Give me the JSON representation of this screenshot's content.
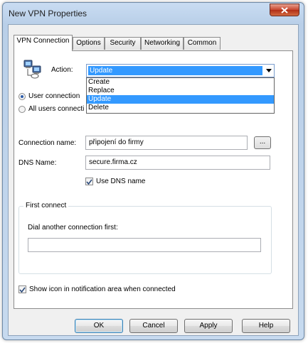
{
  "window": {
    "title": "New VPN Properties"
  },
  "tabs": [
    {
      "label": "VPN Connection",
      "active": true
    },
    {
      "label": "Options",
      "active": false
    },
    {
      "label": "Security",
      "active": false
    },
    {
      "label": "Networking",
      "active": false
    },
    {
      "label": "Common",
      "active": false
    }
  ],
  "action": {
    "label": "Action:",
    "value": "Update",
    "options": [
      "Create",
      "Replace",
      "Update",
      "Delete"
    ],
    "selected_option": "Update"
  },
  "scope": {
    "user_label": "User connection",
    "all_users_label": "All users connecti",
    "selected": "user"
  },
  "connection_name": {
    "label": "Connection name:",
    "value": "připojení do firmy",
    "browse_label": "..."
  },
  "dns": {
    "label": "DNS Name:",
    "value": "secure.firma.cz",
    "use_dns_label": "Use DNS name",
    "use_dns_checked": true
  },
  "first_connect": {
    "legend": "First connect",
    "dial_label": "Dial another connection first:",
    "value": ""
  },
  "notify": {
    "label": "Show icon in notification area when connected",
    "checked": true
  },
  "buttons": {
    "ok": "OK",
    "cancel": "Cancel",
    "apply": "Apply",
    "help": "Help"
  },
  "colors": {
    "selection": "#3399ff",
    "tab_panel": "#ffffff",
    "dialog": "#f0f0f0"
  }
}
